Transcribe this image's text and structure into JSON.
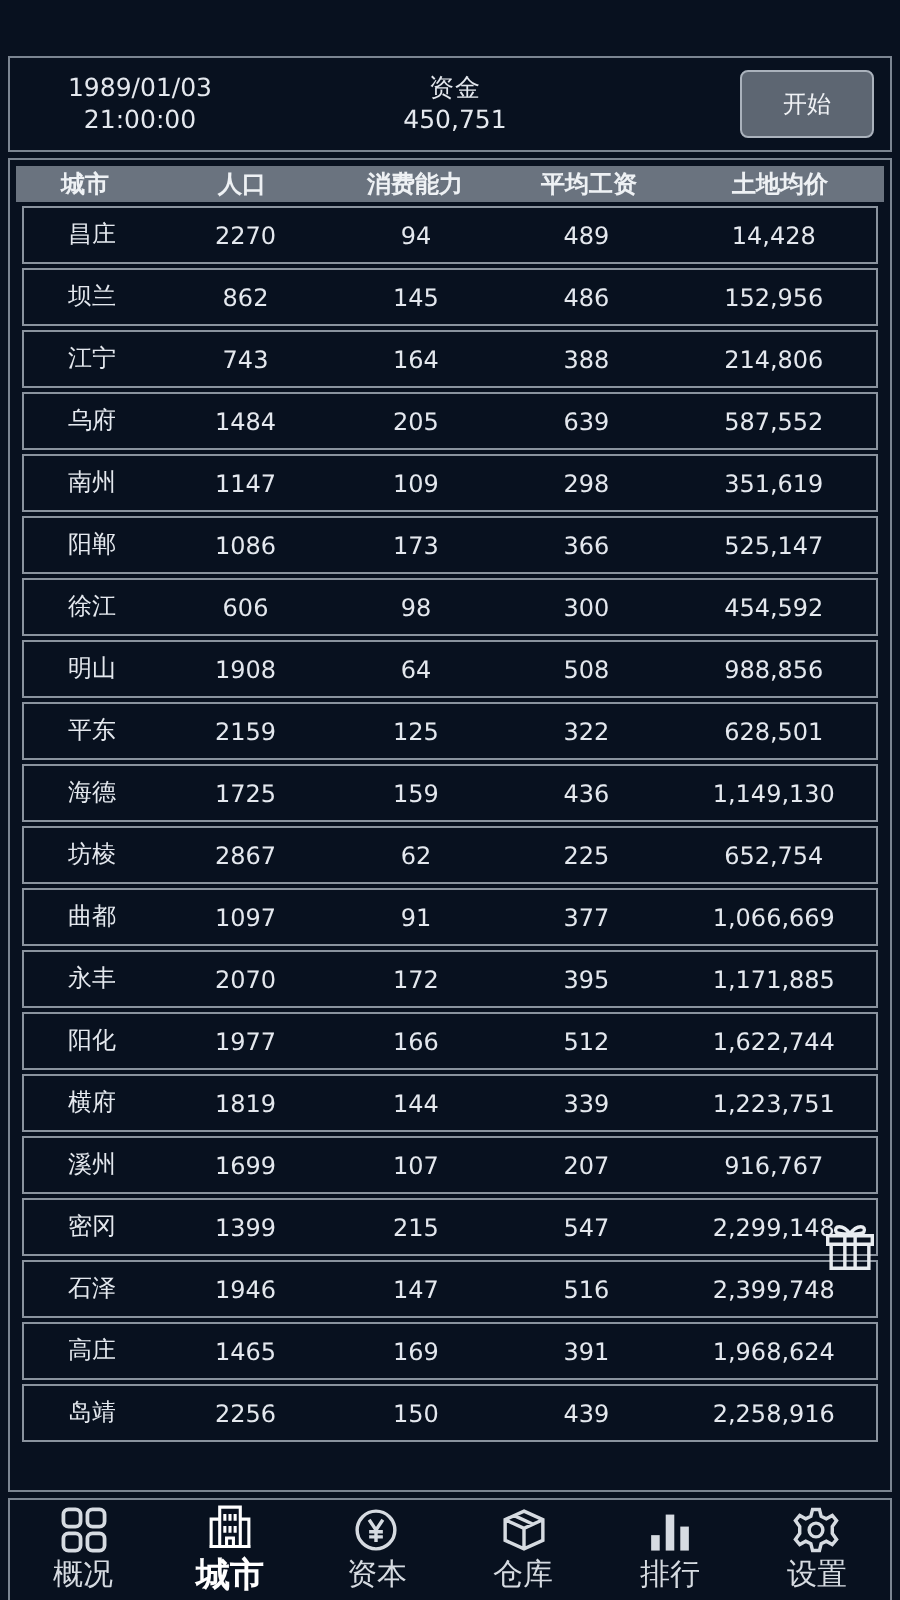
{
  "header": {
    "date": "1989/01/03",
    "time": "21:00:00",
    "funds_label": "资金",
    "funds": "450,751",
    "start_button": "开始"
  },
  "table": {
    "columns": [
      "城市",
      "人口",
      "消费能力",
      "平均工资",
      "土地均价"
    ],
    "rows": [
      [
        "昌庄",
        "2270",
        "94",
        "489",
        "14,428"
      ],
      [
        "坝兰",
        "862",
        "145",
        "486",
        "152,956"
      ],
      [
        "江宁",
        "743",
        "164",
        "388",
        "214,806"
      ],
      [
        "乌府",
        "1484",
        "205",
        "639",
        "587,552"
      ],
      [
        "南州",
        "1147",
        "109",
        "298",
        "351,619"
      ],
      [
        "阳郸",
        "1086",
        "173",
        "366",
        "525,147"
      ],
      [
        "徐江",
        "606",
        "98",
        "300",
        "454,592"
      ],
      [
        "明山",
        "1908",
        "64",
        "508",
        "988,856"
      ],
      [
        "平东",
        "2159",
        "125",
        "322",
        "628,501"
      ],
      [
        "海德",
        "1725",
        "159",
        "436",
        "1,149,130"
      ],
      [
        "坊棱",
        "2867",
        "62",
        "225",
        "652,754"
      ],
      [
        "曲都",
        "1097",
        "91",
        "377",
        "1,066,669"
      ],
      [
        "永丰",
        "2070",
        "172",
        "395",
        "1,171,885"
      ],
      [
        "阳化",
        "1977",
        "166",
        "512",
        "1,622,744"
      ],
      [
        "横府",
        "1819",
        "144",
        "339",
        "1,223,751"
      ],
      [
        "溪州",
        "1699",
        "107",
        "207",
        "916,767"
      ],
      [
        "密冈",
        "1399",
        "215",
        "547",
        "2,299,148"
      ],
      [
        "石泽",
        "1946",
        "147",
        "516",
        "2,399,748"
      ],
      [
        "高庄",
        "1465",
        "169",
        "391",
        "1,968,624"
      ],
      [
        "岛靖",
        "2256",
        "150",
        "439",
        "2,258,916"
      ]
    ]
  },
  "nav": [
    {
      "label": "概况",
      "kind": "grid",
      "selected": false
    },
    {
      "label": "城市",
      "kind": "buildings",
      "selected": true
    },
    {
      "label": "资本",
      "kind": "yen",
      "selected": false
    },
    {
      "label": "仓库",
      "kind": "box",
      "selected": false
    },
    {
      "label": "排行",
      "kind": "bars",
      "selected": false
    },
    {
      "label": "设置",
      "kind": "gear",
      "selected": false
    }
  ]
}
